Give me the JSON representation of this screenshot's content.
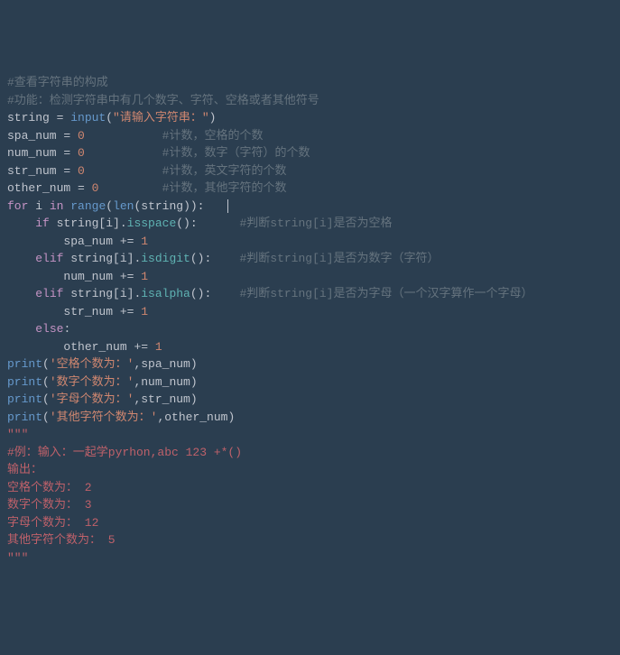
{
  "code": {
    "lines": [
      {
        "segs": [
          {
            "t": "#查看字符串的构成",
            "c": "c-comment"
          }
        ]
      },
      {
        "segs": [
          {
            "t": "#功能：检测字符串中有几个数字、字符、空格或者其他符号",
            "c": "c-comment"
          }
        ]
      },
      {
        "segs": [
          {
            "t": "string ",
            "c": "c-ident"
          },
          {
            "t": "= ",
            "c": "c-op"
          },
          {
            "t": "input",
            "c": "c-builtin"
          },
          {
            "t": "(",
            "c": "c-op"
          },
          {
            "t": "\"请输入字符串：\"",
            "c": "c-string"
          },
          {
            "t": ")",
            "c": "c-op"
          }
        ]
      },
      {
        "segs": [
          {
            "t": "spa_num ",
            "c": "c-ident"
          },
          {
            "t": "= ",
            "c": "c-op"
          },
          {
            "t": "0",
            "c": "c-number"
          },
          {
            "t": "           ",
            "c": "c-ident"
          },
          {
            "t": "#计数，空格的个数",
            "c": "c-comment"
          }
        ]
      },
      {
        "segs": [
          {
            "t": "num_num ",
            "c": "c-ident"
          },
          {
            "t": "= ",
            "c": "c-op"
          },
          {
            "t": "0",
            "c": "c-number"
          },
          {
            "t": "           ",
            "c": "c-ident"
          },
          {
            "t": "#计数，数字（字符）的个数",
            "c": "c-comment"
          }
        ]
      },
      {
        "segs": [
          {
            "t": "str_num ",
            "c": "c-ident"
          },
          {
            "t": "= ",
            "c": "c-op"
          },
          {
            "t": "0",
            "c": "c-number"
          },
          {
            "t": "           ",
            "c": "c-ident"
          },
          {
            "t": "#计数，英文字符的个数",
            "c": "c-comment"
          }
        ]
      },
      {
        "segs": [
          {
            "t": "other_num ",
            "c": "c-ident"
          },
          {
            "t": "= ",
            "c": "c-op"
          },
          {
            "t": "0",
            "c": "c-number"
          },
          {
            "t": "         ",
            "c": "c-ident"
          },
          {
            "t": "#计数，其他字符的个数",
            "c": "c-comment"
          }
        ]
      },
      {
        "segs": [
          {
            "t": "for ",
            "c": "c-keyword"
          },
          {
            "t": "i ",
            "c": "c-ident"
          },
          {
            "t": "in ",
            "c": "c-keyword"
          },
          {
            "t": "range",
            "c": "c-builtin"
          },
          {
            "t": "(",
            "c": "c-op"
          },
          {
            "t": "len",
            "c": "c-builtin"
          },
          {
            "t": "(string)):   ",
            "c": "c-op"
          }
        ],
        "cursor": true
      },
      {
        "segs": [
          {
            "t": "    ",
            "c": ""
          },
          {
            "t": "if ",
            "c": "c-keyword"
          },
          {
            "t": "string[i].",
            "c": "c-ident"
          },
          {
            "t": "isspace",
            "c": "c-func"
          },
          {
            "t": "():      ",
            "c": "c-op"
          },
          {
            "t": "#判断string[i]是否为空格",
            "c": "c-comment"
          }
        ]
      },
      {
        "segs": [
          {
            "t": "        spa_num ",
            "c": "c-ident"
          },
          {
            "t": "+= ",
            "c": "c-op"
          },
          {
            "t": "1",
            "c": "c-number"
          }
        ]
      },
      {
        "segs": [
          {
            "t": "    ",
            "c": ""
          },
          {
            "t": "elif ",
            "c": "c-keyword"
          },
          {
            "t": "string[i].",
            "c": "c-ident"
          },
          {
            "t": "isdigit",
            "c": "c-func"
          },
          {
            "t": "():    ",
            "c": "c-op"
          },
          {
            "t": "#判断string[i]是否为数字（字符）",
            "c": "c-comment"
          }
        ]
      },
      {
        "segs": [
          {
            "t": "        num_num ",
            "c": "c-ident"
          },
          {
            "t": "+= ",
            "c": "c-op"
          },
          {
            "t": "1",
            "c": "c-number"
          }
        ]
      },
      {
        "segs": [
          {
            "t": "    ",
            "c": ""
          },
          {
            "t": "elif ",
            "c": "c-keyword"
          },
          {
            "t": "string[i].",
            "c": "c-ident"
          },
          {
            "t": "isalpha",
            "c": "c-func"
          },
          {
            "t": "():    ",
            "c": "c-op"
          },
          {
            "t": "#判断string[i]是否为字母（一个汉字算作一个字母）",
            "c": "c-comment"
          }
        ]
      },
      {
        "segs": [
          {
            "t": "        str_num ",
            "c": "c-ident"
          },
          {
            "t": "+= ",
            "c": "c-op"
          },
          {
            "t": "1",
            "c": "c-number"
          }
        ]
      },
      {
        "segs": [
          {
            "t": "    ",
            "c": ""
          },
          {
            "t": "else",
            "c": "c-keyword"
          },
          {
            "t": ":",
            "c": "c-op"
          }
        ]
      },
      {
        "segs": [
          {
            "t": "        other_num ",
            "c": "c-ident"
          },
          {
            "t": "+= ",
            "c": "c-op"
          },
          {
            "t": "1",
            "c": "c-number"
          }
        ]
      },
      {
        "segs": [
          {
            "t": "print",
            "c": "c-builtin"
          },
          {
            "t": "(",
            "c": "c-op"
          },
          {
            "t": "'空格个数为：'",
            "c": "c-string"
          },
          {
            "t": ",spa_num)",
            "c": "c-op"
          }
        ]
      },
      {
        "segs": [
          {
            "t": "print",
            "c": "c-builtin"
          },
          {
            "t": "(",
            "c": "c-op"
          },
          {
            "t": "'数字个数为：'",
            "c": "c-string"
          },
          {
            "t": ",num_num)",
            "c": "c-op"
          }
        ]
      },
      {
        "segs": [
          {
            "t": "print",
            "c": "c-builtin"
          },
          {
            "t": "(",
            "c": "c-op"
          },
          {
            "t": "'字母个数为：'",
            "c": "c-string"
          },
          {
            "t": ",str_num)",
            "c": "c-op"
          }
        ]
      },
      {
        "segs": [
          {
            "t": "print",
            "c": "c-builtin"
          },
          {
            "t": "(",
            "c": "c-op"
          },
          {
            "t": "'其他字符个数为：'",
            "c": "c-string"
          },
          {
            "t": ",other_num)",
            "c": "c-op"
          }
        ]
      },
      {
        "segs": [
          {
            "t": "\"\"\"",
            "c": "c-docstr"
          }
        ]
      },
      {
        "segs": [
          {
            "t": "#例：输入：一起学pyrhon,abc 123 +*()",
            "c": "c-docstr"
          }
        ]
      },
      {
        "segs": [
          {
            "t": "输出：",
            "c": "c-docstr"
          }
        ]
      },
      {
        "segs": [
          {
            "t": "空格个数为： 2",
            "c": "c-docstr"
          }
        ]
      },
      {
        "segs": [
          {
            "t": "数字个数为： 3",
            "c": "c-docstr"
          }
        ]
      },
      {
        "segs": [
          {
            "t": "字母个数为： 12",
            "c": "c-docstr"
          }
        ]
      },
      {
        "segs": [
          {
            "t": "其他字符个数为： 5",
            "c": "c-docstr"
          }
        ]
      },
      {
        "segs": [
          {
            "t": "\"\"\"",
            "c": "c-docstr"
          }
        ]
      }
    ]
  }
}
